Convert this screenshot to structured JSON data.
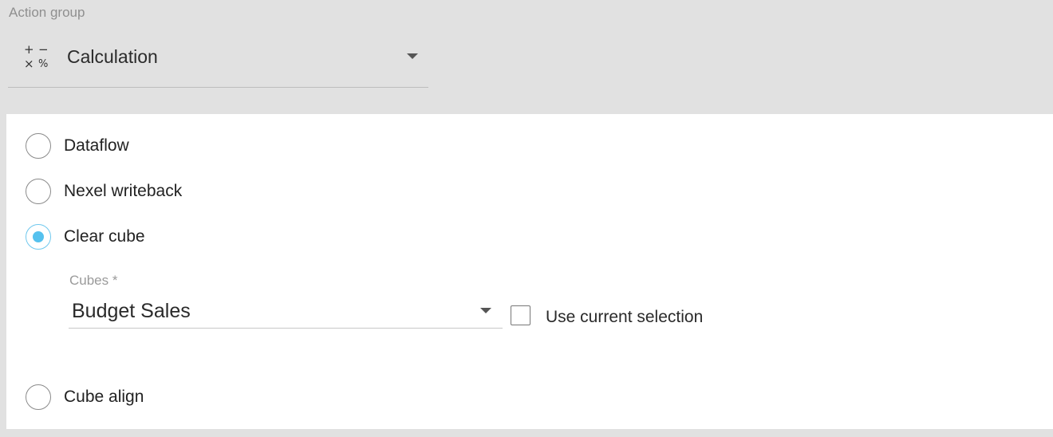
{
  "action_group": {
    "label": "Action group",
    "selected": "Calculation",
    "icon": "calculator-operators-icon",
    "icon_glyphs": {
      "plus": "+",
      "minus": "−",
      "times": "×",
      "percent": "%"
    }
  },
  "options": [
    {
      "label": "Dataflow",
      "checked": false
    },
    {
      "label": "Nexel writeback",
      "checked": false
    },
    {
      "label": "Clear cube",
      "checked": true
    },
    {
      "label": "Cube align",
      "checked": false
    }
  ],
  "clear_cube": {
    "cubes_label": "Cubes *",
    "cubes_value": "Budget Sales",
    "use_current_selection_label": "Use current selection",
    "use_current_selection_checked": false
  },
  "colors": {
    "radio_checked": "#55c1ee",
    "background": "#e1e1e1",
    "panel": "#ffffff"
  }
}
